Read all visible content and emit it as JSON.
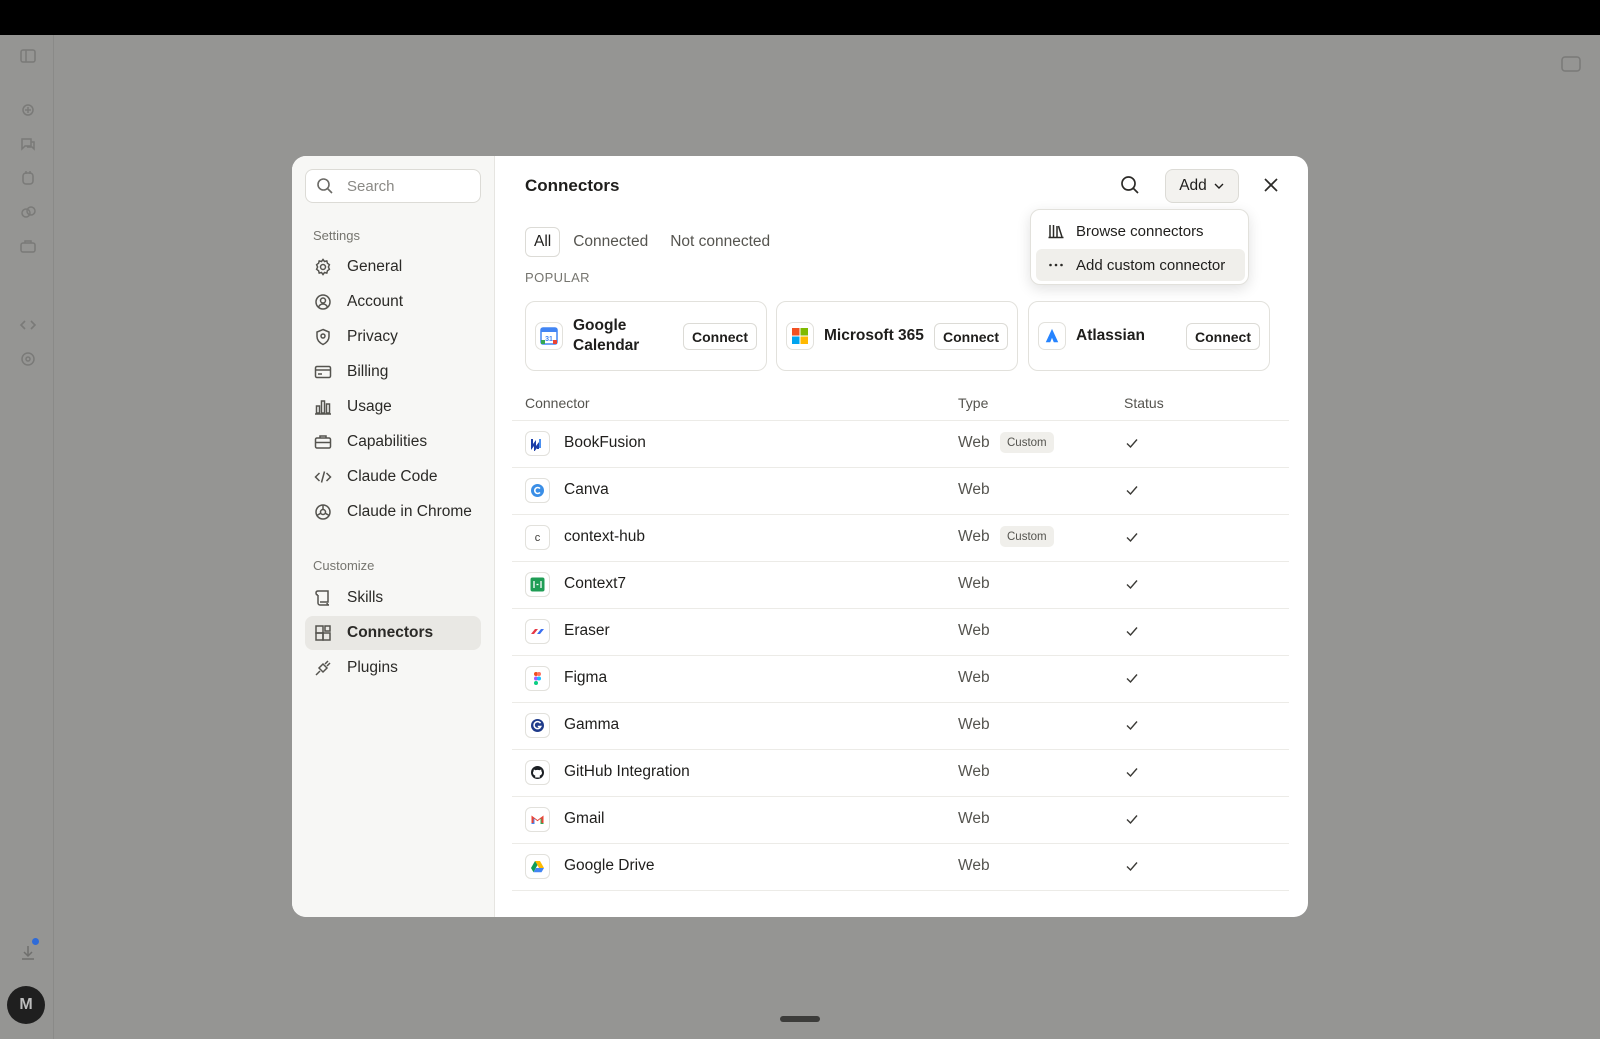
{
  "sidebar": {
    "search_placeholder": "Search",
    "settings_title": "Settings",
    "settings_items": [
      {
        "label": "General",
        "icon": "gear-icon"
      },
      {
        "label": "Account",
        "icon": "user-circle-icon"
      },
      {
        "label": "Privacy",
        "icon": "shield-icon"
      },
      {
        "label": "Billing",
        "icon": "card-icon"
      },
      {
        "label": "Usage",
        "icon": "bar-chart-icon"
      },
      {
        "label": "Capabilities",
        "icon": "briefcase-icon"
      },
      {
        "label": "Claude Code",
        "icon": "code-icon"
      },
      {
        "label": "Claude in Chrome",
        "icon": "globe-icon"
      }
    ],
    "customize_title": "Customize",
    "customize_items": [
      {
        "label": "Skills",
        "icon": "scroll-icon"
      },
      {
        "label": "Connectors",
        "icon": "blocks-icon",
        "active": true
      },
      {
        "label": "Plugins",
        "icon": "plug-icon"
      }
    ]
  },
  "header": {
    "title": "Connectors",
    "add_label": "Add"
  },
  "tabs": [
    "All",
    "Connected",
    "Not connected"
  ],
  "popular": {
    "label": "POPULAR",
    "cards": [
      {
        "name_line1": "Google",
        "name_line2": "Calendar",
        "button": "Connect"
      },
      {
        "name_line1": "Microsoft 365",
        "name_line2": "",
        "button": "Connect"
      },
      {
        "name_line1": "Atlassian",
        "name_line2": "",
        "button": "Connect"
      }
    ]
  },
  "table": {
    "headers": {
      "connector": "Connector",
      "type": "Type",
      "status": "Status"
    },
    "rows": [
      {
        "name": "BookFusion",
        "type": "Web",
        "badge": "Custom"
      },
      {
        "name": "Canva",
        "type": "Web",
        "badge": ""
      },
      {
        "name": "context-hub",
        "type": "Web",
        "badge": "Custom",
        "logo_text": "c"
      },
      {
        "name": "Context7",
        "type": "Web",
        "badge": ""
      },
      {
        "name": "Eraser",
        "type": "Web",
        "badge": ""
      },
      {
        "name": "Figma",
        "type": "Web",
        "badge": ""
      },
      {
        "name": "Gamma",
        "type": "Web",
        "badge": ""
      },
      {
        "name": "GitHub Integration",
        "type": "Web",
        "badge": ""
      },
      {
        "name": "Gmail",
        "type": "Web",
        "badge": ""
      },
      {
        "name": "Google Drive",
        "type": "Web",
        "badge": ""
      }
    ]
  },
  "dropdown": {
    "items": [
      {
        "label": "Browse connectors",
        "icon": "library-icon"
      },
      {
        "label": "Add custom connector",
        "icon": "ellipsis-icon"
      }
    ]
  },
  "user": {
    "avatar_initial": "M"
  },
  "colors": {
    "backdrop": "#959593",
    "active_nav": "#e9e8e4",
    "badge_bg": "#f0efeb"
  }
}
